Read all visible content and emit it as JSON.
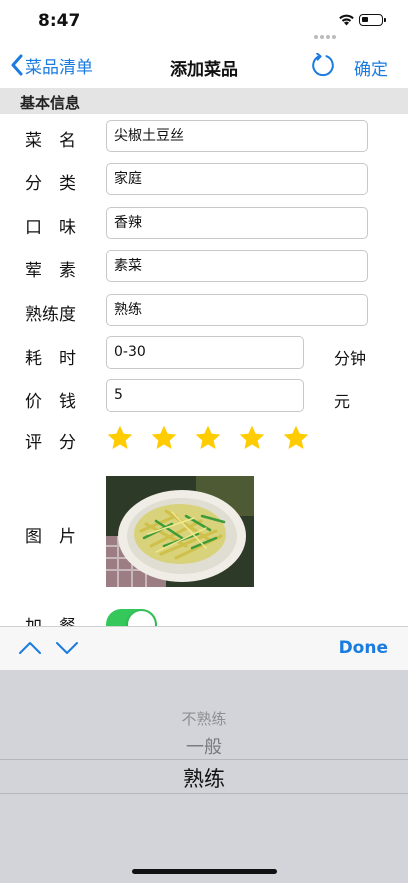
{
  "status_bar": {
    "time": "8:47"
  },
  "nav": {
    "back_label": "菜品清单",
    "title": "添加菜品",
    "confirm_label": "确定"
  },
  "section": {
    "title": "基本信息"
  },
  "form": {
    "name": {
      "label": "菜　名",
      "value": "尖椒土豆丝"
    },
    "category": {
      "label": "分　类",
      "value": "家庭"
    },
    "taste": {
      "label": "口　味",
      "value": "香辣"
    },
    "meat": {
      "label": "荤　素",
      "value": "素菜"
    },
    "skill": {
      "label": "熟练度",
      "value": "熟练"
    },
    "time": {
      "label": "耗　时",
      "value": "0-30",
      "unit": "分钟"
    },
    "price": {
      "label": "价　钱",
      "value": "5",
      "unit": "元"
    },
    "rating": {
      "label": "评　分",
      "stars": 5,
      "max": 5
    },
    "photo": {
      "label": "图　片"
    },
    "extra": {
      "label": "加　餐",
      "on": true
    }
  },
  "toolbar": {
    "done_label": "Done"
  },
  "picker": {
    "options": [
      "不熟练",
      "一般",
      "熟练"
    ],
    "selected": "熟练"
  },
  "colors": {
    "accent": "#1a7be0",
    "star": "#ffcc00",
    "toggle_on": "#34c759"
  }
}
